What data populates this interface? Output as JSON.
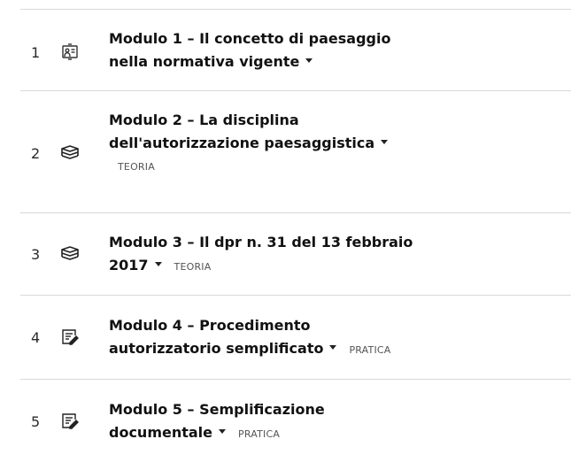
{
  "modules": [
    {
      "number": "1",
      "title_line1": "Modulo 1 – Il concetto di paesaggio",
      "title_line2": "nella normativa vigente",
      "icon": "presentation-icon",
      "badge": ""
    },
    {
      "number": "2",
      "title_line1": "Modulo 2 – La disciplina",
      "title_line2": "dell'autorizzazione paesaggistica",
      "icon": "books-icon",
      "badge": "TEORIA"
    },
    {
      "number": "3",
      "title_line1": "Modulo 3 – Il dpr n. 31 del 13 febbraio",
      "title_line2": "2017",
      "icon": "books-icon",
      "badge": "TEORIA"
    },
    {
      "number": "4",
      "title_line1": "Modulo 4 – Procedimento",
      "title_line2": "autorizzatorio semplificato",
      "icon": "edit-document-icon",
      "badge": "PRATICA"
    },
    {
      "number": "5",
      "title_line1": "Modulo 5 – Semplificazione",
      "title_line2": "documentale",
      "icon": "edit-document-icon",
      "badge": "PRATICA"
    }
  ]
}
